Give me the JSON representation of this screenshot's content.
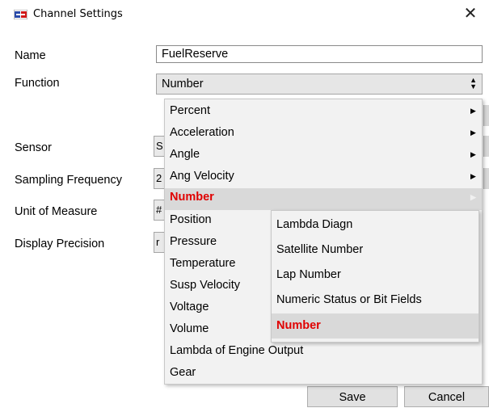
{
  "window": {
    "title": "Channel Settings",
    "close_glyph": "✕",
    "app_icon": "app-logo-icon"
  },
  "form": {
    "name_label": "Name",
    "name_value": "FuelReserve",
    "function_label": "Function",
    "function_value": "Number",
    "sensor_label": "Sensor",
    "sensor_partial": "S",
    "sampling_label": "Sampling Frequency",
    "sampling_partial": "2",
    "unit_label": "Unit of Measure",
    "unit_partial": "#",
    "precision_label": "Display Precision",
    "precision_partial": "r"
  },
  "menu": {
    "items": [
      {
        "label": "Percent",
        "arrow": "▶"
      },
      {
        "label": "Acceleration",
        "arrow": "▶"
      },
      {
        "label": "Angle",
        "arrow": "▶"
      },
      {
        "label": "Ang Velocity",
        "arrow": "▶"
      },
      {
        "label": "Number",
        "arrow": "▶"
      },
      {
        "label": "Position"
      },
      {
        "label": "Pressure"
      },
      {
        "label": "Temperature"
      },
      {
        "label": "Susp Velocity"
      },
      {
        "label": "Voltage"
      },
      {
        "label": "Volume"
      },
      {
        "label": "Lambda of Engine Output"
      },
      {
        "label": "Gear"
      }
    ],
    "selected": "Number"
  },
  "submenu": {
    "items": [
      {
        "label": "Lambda Diagn"
      },
      {
        "label": "Satellite Number"
      },
      {
        "label": "Lap Number"
      },
      {
        "label": "Numeric Status or Bit Fields"
      },
      {
        "label": "Number"
      }
    ],
    "selected": "Number"
  },
  "buttons": {
    "save": "Save",
    "cancel": "Cancel"
  },
  "colors": {
    "selected_text": "#e00000",
    "selected_bg": "#d9d9d9",
    "menu_bg": "#f2f2f2"
  }
}
